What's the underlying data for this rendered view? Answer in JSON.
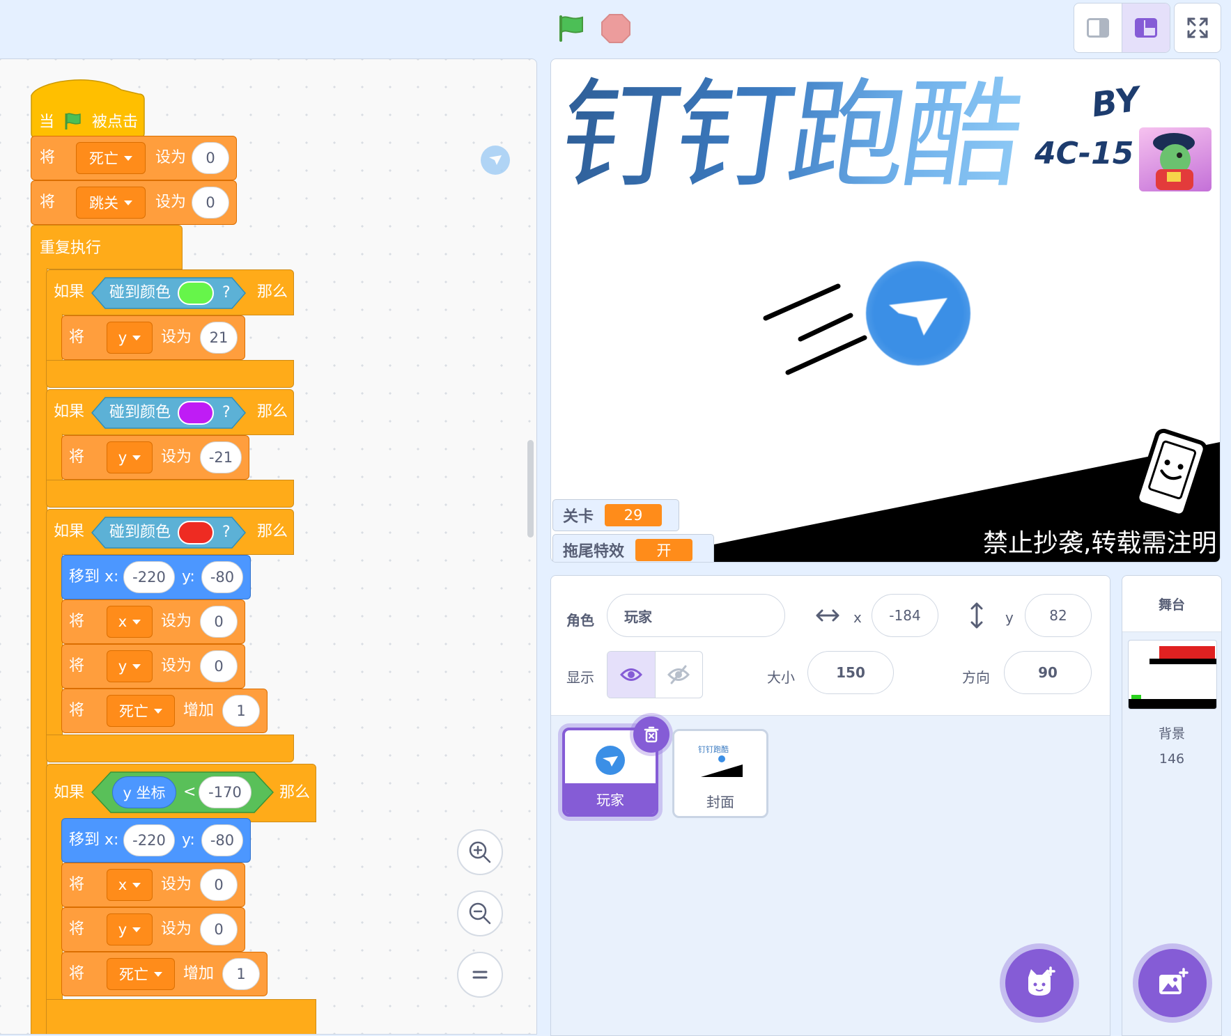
{
  "topbar": {
    "green_flag_icon": "green-flag-icon",
    "stop_icon": "stop-icon",
    "small_stage_icon": "small-stage-icon",
    "normal_stage_icon": "normal-stage-icon",
    "fullscreen_icon": "fullscreen-icon"
  },
  "colors": {
    "motion": "#4c97ff",
    "variables": "#ff8c1a",
    "control": "#ffab19",
    "events": "#ffbf00",
    "sensing": "#5cb1d6",
    "operators": "#59c059",
    "accent": "#855cd6"
  },
  "script": {
    "hat": {
      "when": "当",
      "clicked": "被点击"
    },
    "set_die": {
      "op": "将",
      "var": "死亡",
      "to": "设为",
      "value": "0"
    },
    "set_jump": {
      "op": "将",
      "var": "跳关",
      "to": "设为",
      "value": "0"
    },
    "forever": "重复执行",
    "if1": {
      "if": "如果",
      "touch": "碰到颜色",
      "q": "?",
      "then": "那么",
      "color": "#66f54a",
      "set": {
        "op": "将",
        "var": "y",
        "to": "设为",
        "value": "21"
      }
    },
    "if2": {
      "if": "如果",
      "touch": "碰到颜色",
      "q": "?",
      "then": "那么",
      "color": "#bf1cf5",
      "set": {
        "op": "将",
        "var": "y",
        "to": "设为",
        "value": "-21"
      }
    },
    "if3": {
      "if": "如果",
      "touch": "碰到颜色",
      "q": "?",
      "then": "那么",
      "color": "#ee2b22",
      "goto": {
        "label": "移到 x:",
        "x": "-220",
        "ylabel": "y:",
        "y": "-80"
      },
      "setx": {
        "op": "将",
        "var": "x",
        "to": "设为",
        "value": "0"
      },
      "sety": {
        "op": "将",
        "var": "y",
        "to": "设为",
        "value": "0"
      },
      "change": {
        "op": "将",
        "var": "死亡",
        "by": "增加",
        "value": "1"
      }
    },
    "if4": {
      "if": "如果",
      "reporter": "y 坐标",
      "lt": "<",
      "value": "-170",
      "then": "那么",
      "goto": {
        "label": "移到 x:",
        "x": "-220",
        "ylabel": "y:",
        "y": "-80"
      },
      "setx": {
        "op": "将",
        "var": "x",
        "to": "设为",
        "value": "0"
      },
      "sety": {
        "op": "将",
        "var": "y",
        "to": "设为",
        "value": "0"
      },
      "change": {
        "op": "将",
        "var": "死亡",
        "by": "增加",
        "value": "1"
      }
    }
  },
  "zoom": {
    "in_icon": "zoom-in-icon",
    "out_icon": "zoom-out-icon",
    "reset_icon": "zoom-reset-icon"
  },
  "stage": {
    "title": "钉钉跑酷",
    "byline1": "BY",
    "byline2": "4C-15",
    "copyright": "禁止抄袭,转载需注明",
    "monitors": [
      {
        "label": "关卡",
        "value": "29"
      },
      {
        "label": "拖尾特效",
        "value": "开"
      }
    ]
  },
  "sprite_info": {
    "sprite_label": "角色",
    "sprite_name": "玩家",
    "x_label": "x",
    "x_value": "-184",
    "y_label": "y",
    "y_value": "82",
    "show_label": "显示",
    "size_label": "大小",
    "size_value": "150",
    "direction_label": "方向",
    "direction_value": "90"
  },
  "sprites": [
    {
      "name": "玩家",
      "selected": true
    },
    {
      "name": "封面",
      "selected": false
    }
  ],
  "thumb_cover": {
    "title": "钉钉跑酷"
  },
  "stage_selector": {
    "title": "舞台",
    "backdrops_label": "背景",
    "backdrops_count": "146"
  }
}
